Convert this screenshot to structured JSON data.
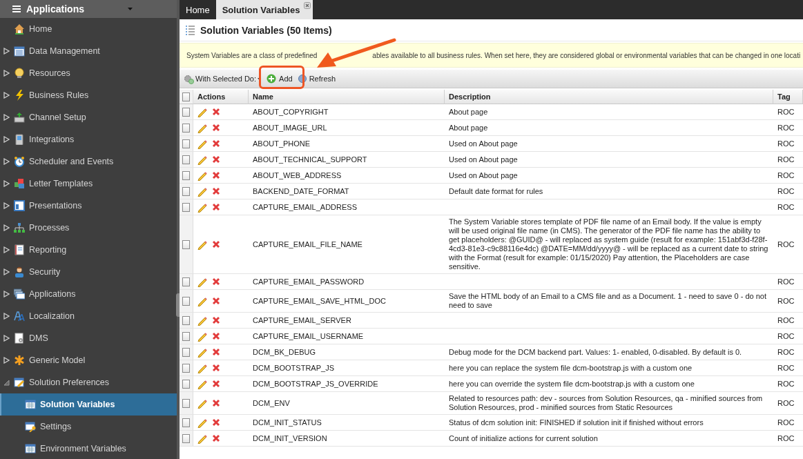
{
  "sidebar": {
    "title": "Applications",
    "items": [
      {
        "label": "Home",
        "kind": "leaf",
        "selected": false
      },
      {
        "label": "Data Management",
        "kind": "group",
        "expanded": false,
        "selected": false
      },
      {
        "label": "Resources",
        "kind": "group",
        "expanded": false,
        "selected": false
      },
      {
        "label": "Business Rules",
        "kind": "group",
        "expanded": false,
        "selected": false
      },
      {
        "label": "Channel Setup",
        "kind": "group",
        "expanded": false,
        "selected": false
      },
      {
        "label": "Integrations",
        "kind": "group",
        "expanded": false,
        "selected": false
      },
      {
        "label": "Scheduler and Events",
        "kind": "group",
        "expanded": false,
        "selected": false
      },
      {
        "label": "Letter Templates",
        "kind": "group",
        "expanded": false,
        "selected": false
      },
      {
        "label": "Presentations",
        "kind": "group",
        "expanded": false,
        "selected": false
      },
      {
        "label": "Processes",
        "kind": "group",
        "expanded": false,
        "selected": false
      },
      {
        "label": "Reporting",
        "kind": "group",
        "expanded": false,
        "selected": false
      },
      {
        "label": "Security",
        "kind": "group",
        "expanded": false,
        "selected": false
      },
      {
        "label": "Applications",
        "kind": "group",
        "expanded": false,
        "selected": false
      },
      {
        "label": "Localization",
        "kind": "group",
        "expanded": false,
        "selected": false
      },
      {
        "label": "DMS",
        "kind": "group",
        "expanded": false,
        "selected": false
      },
      {
        "label": "Generic Model",
        "kind": "group",
        "expanded": false,
        "selected": false
      },
      {
        "label": "Solution Preferences",
        "kind": "group",
        "expanded": true,
        "selected": false,
        "children": [
          {
            "label": "Solution Variables",
            "selected": true
          },
          {
            "label": "Settings",
            "selected": false
          },
          {
            "label": "Environment Variables",
            "selected": false
          }
        ]
      }
    ]
  },
  "tabs": [
    {
      "label": "Home",
      "selected": false,
      "closable": false
    },
    {
      "label": "Solution Variables",
      "selected": true,
      "closable": true
    }
  ],
  "page": {
    "title": "Solution Variables (50 Items)",
    "banner": [
      "System Variables are a class of predefined",
      "ables available to all business rules. When set here, they are considered global or environmental variables that can be changed in one locati"
    ]
  },
  "toolbar": {
    "bulk_action": "With Selected Do:",
    "buttons": [
      {
        "label": "Add",
        "kind": "add"
      },
      {
        "label": "Refresh",
        "kind": "refresh"
      }
    ]
  },
  "annotations": {
    "arrow": true,
    "highlight": true
  },
  "table": {
    "columns": [
      "Actions",
      "Name",
      "Description",
      "Tag"
    ],
    "all_checked": false,
    "rows": [
      {
        "checked": false,
        "name": "ABOUT_COPYRIGHT",
        "description": "About page",
        "tag": "ROC"
      },
      {
        "checked": false,
        "name": "ABOUT_IMAGE_URL",
        "description": "About page",
        "tag": "ROC"
      },
      {
        "checked": false,
        "name": "ABOUT_PHONE",
        "description": "Used on About page",
        "tag": "ROC"
      },
      {
        "checked": false,
        "name": "ABOUT_TECHNICAL_SUPPORT",
        "description": "Used on About page",
        "tag": "ROC"
      },
      {
        "checked": false,
        "name": "ABOUT_WEB_ADDRESS",
        "description": "Used on About page",
        "tag": "ROC"
      },
      {
        "checked": false,
        "name": "BACKEND_DATE_FORMAT",
        "description": "Default date format for rules",
        "tag": "ROC"
      },
      {
        "checked": false,
        "name": "CAPTURE_EMAIL_ADDRESS",
        "tag": "ROC"
      },
      {
        "checked": false,
        "name": "CAPTURE_EMAIL_FILE_NAME",
        "description": "The System Variable stores template of PDF file name of an Email body. If the value is empty will be used original file name (in CMS). The generator of the PDF file name has the ability to get placeholders: @GUID@ - will replaced as system guide (result for example: 151abf3d-f28f-4cd3-81e3-c9c88116e4dc) @DATE=MM/dd/yyyy@ - will be replaced as a current date to string with the Format (result for example: 01/15/2020) Pay attention, the Placeholders are case sensitive.",
        "tag": "ROC"
      },
      {
        "checked": false,
        "name": "CAPTURE_EMAIL_PASSWORD",
        "tag": "ROC"
      },
      {
        "checked": false,
        "name": "CAPTURE_EMAIL_SAVE_HTML_DOC",
        "description": "Save the HTML body of an Email to a CMS file and as a Document. 1 - need to save 0 - do not need to save",
        "tag": "ROC"
      },
      {
        "checked": false,
        "name": "CAPTURE_EMAIL_SERVER",
        "tag": "ROC"
      },
      {
        "checked": false,
        "name": "CAPTURE_EMAIL_USERNAME",
        "tag": "ROC"
      },
      {
        "checked": false,
        "name": "DCM_BK_DEBUG",
        "description": "Debug mode for the DCM backend part. Values: 1- enabled, 0-disabled. By default is 0.",
        "tag": "ROC"
      },
      {
        "checked": false,
        "name": "DCM_BOOTSTRAP_JS",
        "description": "here you can replace the system file dcm-bootstrap.js with a custom one",
        "tag": "ROC"
      },
      {
        "checked": false,
        "name": "DCM_BOOTSTRAP_JS_OVERRIDE",
        "description": "here you can override the system file dcm-bootstrap.js with a custom one",
        "tag": "ROC"
      },
      {
        "checked": false,
        "name": "DCM_ENV",
        "description": "Related to resources path: dev - sources from Solution Resources, qa - minified sources from Solution Resources, prod - minified sources from Static Resources",
        "tag": "ROC"
      },
      {
        "checked": false,
        "name": "DCM_INIT_STATUS",
        "description": "Status of dcm solution init: FINISHED if solution init if finished without errors",
        "tag": "ROC"
      },
      {
        "checked": false,
        "name": "DCM_INIT_VERSION",
        "description": "Count of initialize actions for current solution",
        "tag": "ROC"
      }
    ]
  }
}
